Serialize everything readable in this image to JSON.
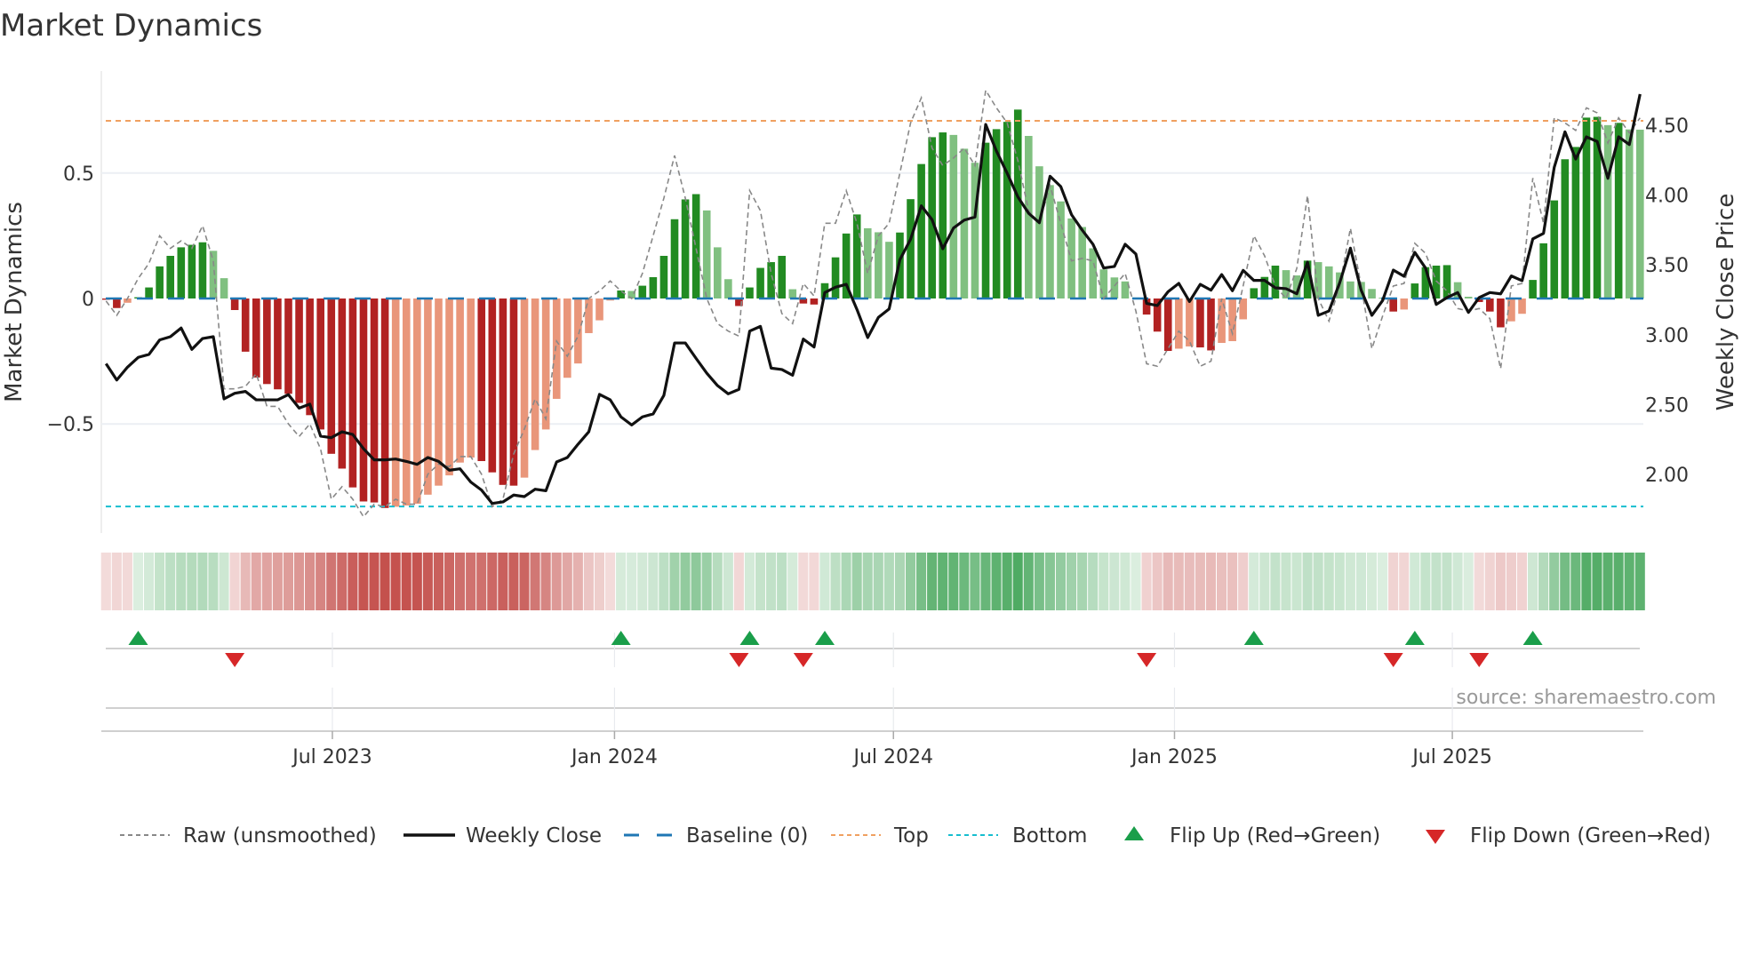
{
  "chart_data": {
    "type": "bar",
    "title": "Market Dynamics",
    "ylabel": "Market Dynamics",
    "ylabel_right": "Weekly Close Price",
    "source": "source: sharemaestro.com",
    "ylim": [
      -0.86,
      0.86
    ],
    "ylim_right": [
      1.75,
      4.85
    ],
    "y_left_ticks": [
      {
        "value": 0.5,
        "label": "0.5"
      },
      {
        "value": 0,
        "label": "0"
      },
      {
        "value": -0.5,
        "label": "−0.5"
      }
    ],
    "y_right_ticks": [
      {
        "value": 4.5,
        "label": "4.50"
      },
      {
        "value": 4.0,
        "label": "4.00"
      },
      {
        "value": 3.5,
        "label": "3.50"
      },
      {
        "value": 3.0,
        "label": "3.00"
      },
      {
        "value": 2.5,
        "label": "2.50"
      },
      {
        "value": 2.0,
        "label": "2.00"
      }
    ],
    "x_ticks": [
      {
        "week": 21.1,
        "label": "Jul 2023"
      },
      {
        "week": 47.4,
        "label": "Jan 2024"
      },
      {
        "week": 73.4,
        "label": "Jul 2024"
      },
      {
        "week": 99.6,
        "label": "Jan 2025"
      },
      {
        "week": 125.5,
        "label": "Jul 2025"
      }
    ],
    "top_level": 0.708,
    "bottom_level": -0.829,
    "baseline": 0,
    "colors": {
      "strong_up": "#228b22",
      "weak_up": "#80c080",
      "strong_down": "#b22222",
      "weak_down": "#e9967a",
      "baseline": "#1f77b4",
      "top": "#f0a060",
      "bottom": "#17becf",
      "raw": "#888888",
      "close": "#111111",
      "flip_up": "#1a9e4a",
      "flip_down": "#d62728"
    },
    "legend": [
      {
        "label": "Raw (unsmoothed)",
        "kind": "raw"
      },
      {
        "label": "Weekly Close",
        "kind": "close"
      },
      {
        "label": "Baseline (0)",
        "kind": "baseline"
      },
      {
        "label": "Top",
        "kind": "top"
      },
      {
        "label": "Bottom",
        "kind": "bottom"
      },
      {
        "label": "Flip Up (Red→Green)",
        "kind": "flip_up"
      },
      {
        "label": "Flip Down (Green→Red)",
        "kind": "flip_down"
      }
    ],
    "flip_up_weeks": [
      3,
      48,
      60,
      67,
      107,
      122,
      133
    ],
    "flip_down_weeks": [
      12,
      59,
      65,
      97,
      120,
      128
    ],
    "series": [
      {
        "name": "Market Dynamics",
        "values": [
          -0.005,
          -0.038,
          -0.017,
          0.005,
          0.044,
          0.128,
          0.17,
          0.204,
          0.214,
          0.224,
          0.19,
          0.081,
          -0.046,
          -0.212,
          -0.315,
          -0.341,
          -0.362,
          -0.38,
          -0.416,
          -0.465,
          -0.522,
          -0.619,
          -0.678,
          -0.753,
          -0.809,
          -0.813,
          -0.835,
          -0.83,
          -0.825,
          -0.818,
          -0.782,
          -0.746,
          -0.705,
          -0.654,
          -0.634,
          -0.648,
          -0.693,
          -0.743,
          -0.746,
          -0.714,
          -0.604,
          -0.522,
          -0.4,
          -0.316,
          -0.259,
          -0.138,
          -0.087,
          -0.008,
          0.032,
          0.03,
          0.051,
          0.085,
          0.17,
          0.316,
          0.395,
          0.416,
          0.351,
          0.204,
          0.077,
          -0.03,
          0.044,
          0.122,
          0.145,
          0.17,
          0.037,
          -0.02,
          -0.024,
          0.061,
          0.164,
          0.259,
          0.335,
          0.28,
          0.264,
          0.226,
          0.263,
          0.396,
          0.536,
          0.643,
          0.662,
          0.652,
          0.597,
          0.541,
          0.621,
          0.675,
          0.704,
          0.753,
          0.648,
          0.527,
          0.452,
          0.387,
          0.319,
          0.285,
          0.2,
          0.116,
          0.084,
          0.068,
          0.004,
          -0.064,
          -0.132,
          -0.209,
          -0.2,
          -0.191,
          -0.195,
          -0.207,
          -0.177,
          -0.17,
          -0.083,
          0.041,
          0.086,
          0.131,
          0.113,
          0.092,
          0.151,
          0.145,
          0.128,
          0.104,
          0.068,
          0.066,
          0.038,
          0.003,
          -0.052,
          -0.044,
          0.06,
          0.125,
          0.131,
          0.133,
          0.065,
          0.007,
          -0.014,
          -0.052,
          -0.115,
          -0.091,
          -0.061,
          0.074,
          0.22,
          0.391,
          0.555,
          0.604,
          0.721,
          0.724,
          0.691,
          0.7,
          0.674,
          0.673
        ]
      },
      {
        "name": "Raw (unsmoothed)",
        "values": [
          -0.01,
          -0.067,
          0.0,
          0.08,
          0.14,
          0.25,
          0.2,
          0.23,
          0.2,
          0.29,
          0.15,
          -0.36,
          -0.36,
          -0.35,
          -0.3,
          -0.43,
          -0.43,
          -0.5,
          -0.55,
          -0.5,
          -0.6,
          -0.8,
          -0.75,
          -0.8,
          -0.87,
          -0.82,
          -0.83,
          -0.8,
          -0.82,
          -0.82,
          -0.7,
          -0.66,
          -0.67,
          -0.63,
          -0.63,
          -0.7,
          -0.83,
          -0.8,
          -0.62,
          -0.52,
          -0.4,
          -0.48,
          -0.17,
          -0.23,
          -0.15,
          0.0,
          0.03,
          0.07,
          0.03,
          0.0,
          0.1,
          0.25,
          0.4,
          0.57,
          0.4,
          0.2,
          0.0,
          -0.1,
          -0.13,
          -0.15,
          0.43,
          0.35,
          0.1,
          -0.06,
          -0.1,
          0.06,
          0.01,
          0.3,
          0.3,
          0.43,
          0.3,
          0.1,
          0.25,
          0.3,
          0.5,
          0.7,
          0.8,
          0.6,
          0.53,
          0.56,
          0.6,
          0.53,
          0.83,
          0.76,
          0.7,
          0.55,
          0.35,
          0.3,
          0.45,
          0.3,
          0.15,
          0.16,
          0.15,
          0.0,
          0.05,
          0.1,
          -0.05,
          -0.26,
          -0.27,
          -0.2,
          -0.13,
          -0.17,
          -0.27,
          -0.25,
          0.0,
          -0.14,
          0.05,
          0.25,
          0.17,
          0.05,
          0.0,
          0.12,
          0.41,
          0.0,
          -0.09,
          0.05,
          0.28,
          0.05,
          -0.2,
          -0.07,
          0.05,
          0.06,
          0.22,
          0.18,
          0.07,
          0.03,
          -0.04,
          -0.05,
          -0.04,
          -0.08,
          -0.28,
          0.05,
          0.06,
          0.48,
          0.3,
          0.72,
          0.7,
          0.67,
          0.76,
          0.74,
          0.62,
          0.72,
          0.66,
          0.72
        ]
      },
      {
        "name": "Weekly Close",
        "values": [
          2.793,
          2.676,
          2.768,
          2.838,
          2.859,
          2.963,
          2.986,
          3.048,
          2.895,
          2.973,
          2.986,
          2.541,
          2.581,
          2.594,
          2.534,
          2.534,
          2.534,
          2.571,
          2.475,
          2.503,
          2.274,
          2.263,
          2.305,
          2.286,
          2.184,
          2.104,
          2.104,
          2.11,
          2.093,
          2.072,
          2.121,
          2.093,
          2.03,
          2.04,
          1.945,
          1.888,
          1.792,
          1.803,
          1.852,
          1.841,
          1.894,
          1.883,
          2.089,
          2.121,
          2.216,
          2.305,
          2.573,
          2.534,
          2.412,
          2.354,
          2.412,
          2.433,
          2.566,
          2.941,
          2.941,
          2.831,
          2.725,
          2.636,
          2.577,
          2.609,
          3.026,
          3.06,
          2.761,
          2.751,
          2.71,
          2.969,
          2.912,
          3.302,
          3.34,
          3.361,
          3.181,
          2.98,
          3.124,
          3.185,
          3.537,
          3.684,
          3.923,
          3.824,
          3.616,
          3.764,
          3.821,
          3.843,
          4.506,
          4.316,
          4.157,
          3.987,
          3.87,
          3.802,
          4.135,
          4.061,
          3.86,
          3.749,
          3.648,
          3.478,
          3.489,
          3.648,
          3.578,
          3.224,
          3.209,
          3.308,
          3.368,
          3.238,
          3.361,
          3.319,
          3.431,
          3.315,
          3.461,
          3.389,
          3.389,
          3.336,
          3.33,
          3.293,
          3.52,
          3.139,
          3.17,
          3.372,
          3.62,
          3.319,
          3.139,
          3.245,
          3.463,
          3.419,
          3.59,
          3.478,
          3.217,
          3.266,
          3.302,
          3.16,
          3.266,
          3.302,
          3.293,
          3.421,
          3.387,
          3.686,
          3.726,
          4.199,
          4.453,
          4.258,
          4.417,
          4.384,
          4.12,
          4.417,
          4.362,
          4.723
        ]
      }
    ]
  }
}
